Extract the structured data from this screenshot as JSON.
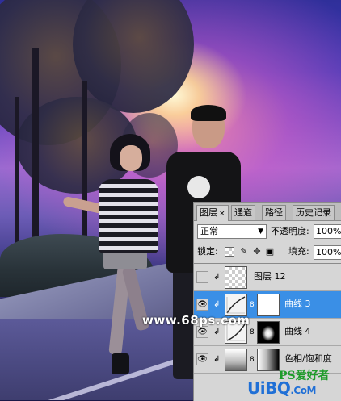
{
  "layers_panel": {
    "tabs": [
      {
        "label": "图层",
        "close": "×",
        "active": true
      },
      {
        "label": "通道",
        "active": false
      },
      {
        "label": "路径",
        "active": false
      },
      {
        "label": "历史记录",
        "active": false
      }
    ],
    "blend_mode": "正常",
    "opacity_label": "不透明度:",
    "opacity_value": "100%",
    "lock_label": "锁定:",
    "lock_icons": [
      "transparency-lock-icon",
      "brush-lock-icon",
      "move-lock-icon",
      "padlock-icon"
    ],
    "fill_label": "填充:",
    "fill_value": "100%",
    "layers": [
      {
        "name": "图层 12",
        "visible": false,
        "clipped": true,
        "selected": false,
        "thumb": "transparent"
      },
      {
        "name": "曲线 3",
        "visible": true,
        "clipped": true,
        "selected": true,
        "thumb": "curves",
        "mask": "white"
      },
      {
        "name": "曲线 4",
        "visible": true,
        "clipped": true,
        "selected": false,
        "thumb": "curves",
        "mask": "radial-dark"
      },
      {
        "name": "色相/饱和度",
        "visible": true,
        "clipped": true,
        "selected": false,
        "thumb": "hue-saturation",
        "mask": "gradient"
      }
    ]
  },
  "watermarks": {
    "site_68ps": "www.68ps.com",
    "ps_lover": "PS爱好者",
    "uibq_main": "UiBQ",
    "uibq_suffix": ".CoM"
  },
  "colors": {
    "selection_blue": "#3a8fe6",
    "panel_gray": "#d6d6d6"
  }
}
